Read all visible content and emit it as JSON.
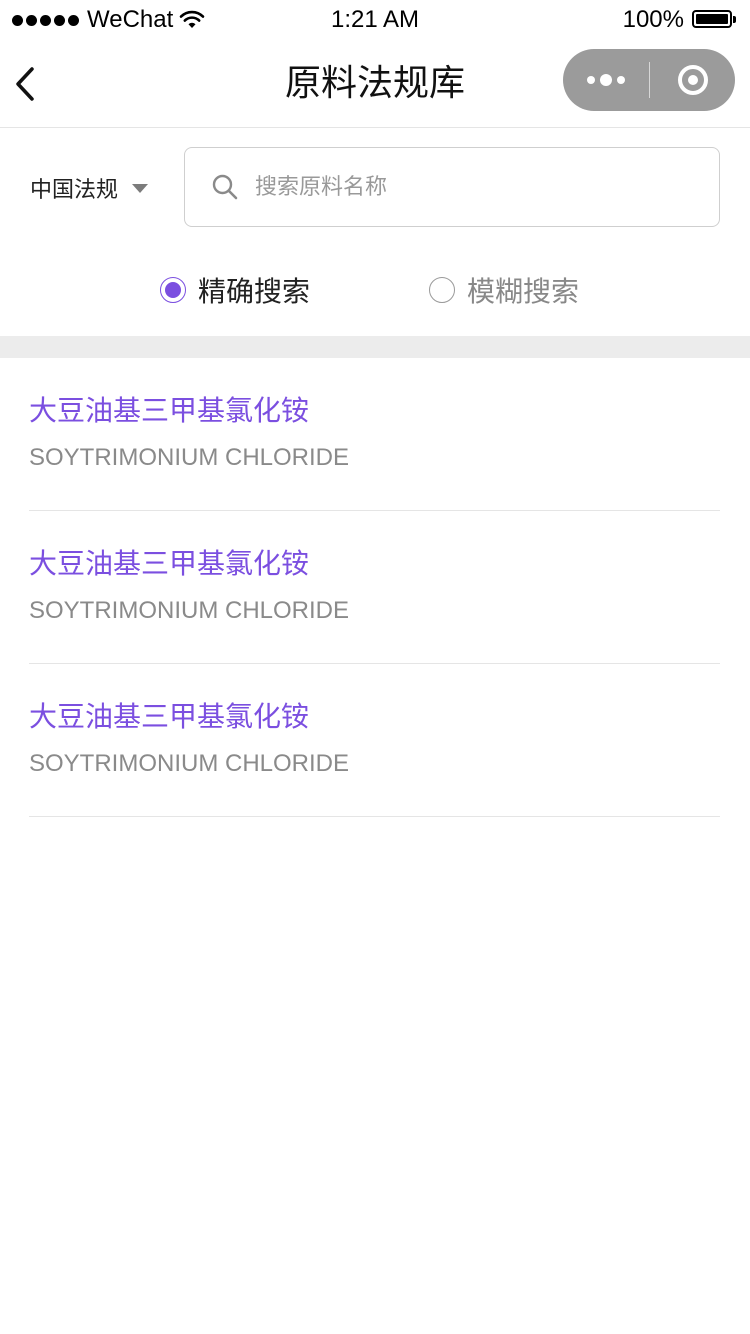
{
  "status_bar": {
    "carrier": "WeChat",
    "time": "1:21 AM",
    "battery": "100%"
  },
  "nav": {
    "title": "原料法规库",
    "back_icon": "chevron-left-icon",
    "more_icon": "more-dots-icon",
    "close_icon": "target-circle-icon"
  },
  "filter": {
    "region_label": "中国法规",
    "search_placeholder": "搜索原料名称",
    "search_value": ""
  },
  "search_mode": {
    "options": [
      {
        "label": "精确搜索",
        "selected": true
      },
      {
        "label": "模糊搜索",
        "selected": false
      }
    ]
  },
  "results": [
    {
      "name": "大豆油基三甲基氯化铵",
      "latin": "SOYTRIMONIUM CHLORIDE"
    },
    {
      "name": "大豆油基三甲基氯化铵",
      "latin": "SOYTRIMONIUM CHLORIDE"
    },
    {
      "name": "大豆油基三甲基氯化铵",
      "latin": "SOYTRIMONIUM CHLORIDE"
    }
  ],
  "colors": {
    "accent": "#7b4fe0",
    "capsule": "#9b9b9b",
    "band": "#ececec"
  }
}
